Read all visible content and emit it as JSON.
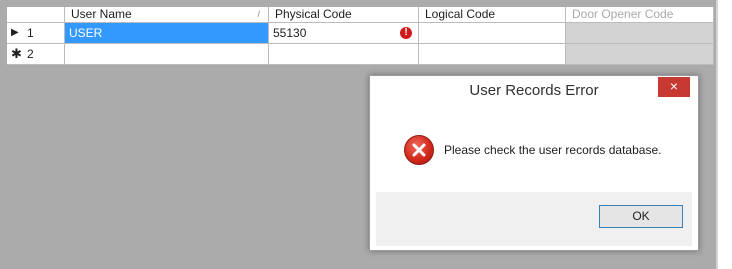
{
  "grid": {
    "columns": [
      {
        "label": "User Name",
        "sort_glyph": "/"
      },
      {
        "label": "Physical Code"
      },
      {
        "label": "Logical Code"
      },
      {
        "label": "Door Opener Code"
      }
    ],
    "rows": [
      {
        "indicator": "current-row-arrow",
        "number": "1",
        "user_name": "USER",
        "physical_code": "55130",
        "logical_code": "",
        "door_opener_code": "",
        "has_error": true
      },
      {
        "indicator": "new-row-star",
        "number": "2",
        "user_name": "",
        "physical_code": "",
        "logical_code": "",
        "door_opener_code": ""
      }
    ],
    "colors": {
      "selection": "#3399ff",
      "empty_area": "#ababab",
      "error": "#d11a1a"
    }
  },
  "dialog": {
    "title": "User Records Error",
    "close_label": "×",
    "message": "Please check the user records database.",
    "icon": "error-icon",
    "ok_label": "OK"
  }
}
